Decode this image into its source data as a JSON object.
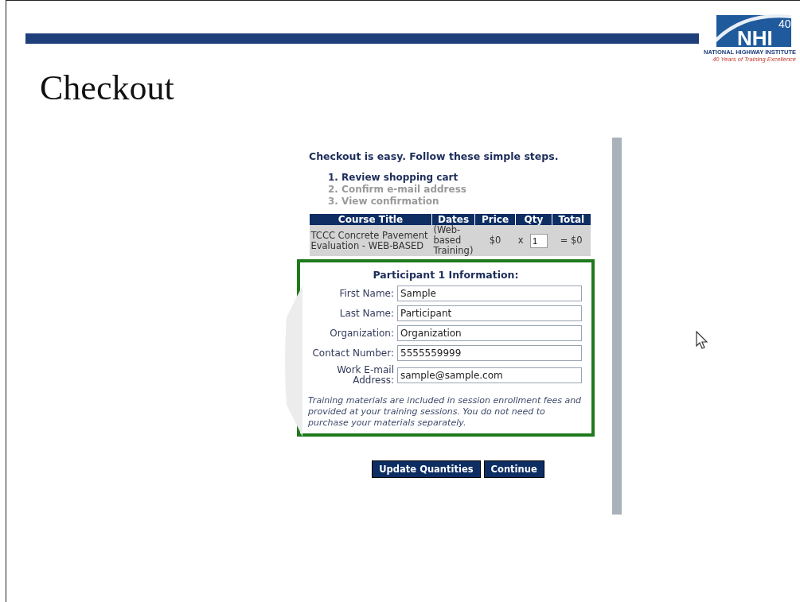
{
  "slide": {
    "title": "Checkout"
  },
  "logo": {
    "number": "40",
    "acronym": "NHI",
    "name": "NATIONAL HIGHWAY INSTITUTE",
    "tagline": "40 Years of Training Excellence"
  },
  "checkout": {
    "intro": "Checkout is easy. Follow these simple steps.",
    "steps": [
      {
        "number": "1.",
        "label": "Review shopping cart",
        "selected": true
      },
      {
        "number": "2.",
        "label": "Confirm e-mail address",
        "selected": false
      },
      {
        "number": "3.",
        "label": "View confirmation",
        "selected": false
      }
    ],
    "table": {
      "columns": [
        "Course Title",
        "Dates",
        "Price",
        "Qty",
        "Total"
      ],
      "rows": [
        {
          "title": "TCCC Concrete Pavement Evaluation - WEB-BASED",
          "dates": "(Web-based Training)",
          "price": "$0",
          "times": "x",
          "qty": "1",
          "total": "= $0"
        }
      ]
    },
    "participant": {
      "heading": "Participant 1 Information:",
      "fields": [
        {
          "label": "First Name:",
          "value": "Sample"
        },
        {
          "label": "Last Name:",
          "value": "Participant"
        },
        {
          "label": "Organization:",
          "value": "Organization"
        },
        {
          "label": "Contact Number:",
          "value": "5555559999"
        },
        {
          "label": "Work E-mail Address:",
          "value": "sample@sample.com"
        }
      ],
      "note": "Training materials are included in session enrollment fees and provided at your training sessions. You do not need to purchase your materials separately."
    },
    "buttons": [
      "Update Quantities",
      "Continue"
    ]
  }
}
